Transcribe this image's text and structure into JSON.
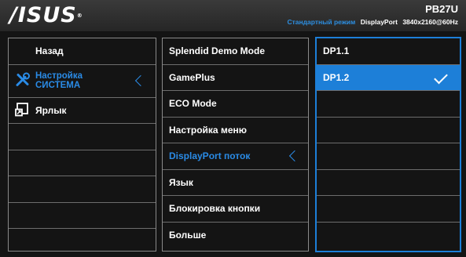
{
  "header": {
    "logo": "/ISUS",
    "model": "PB27U",
    "mode": "Стандартный режим",
    "input": "DisplayPort",
    "resolution": "3840x2160@60Hz"
  },
  "col1": {
    "back": "Назад",
    "system_line1": "Настройка",
    "system_line2": "СИСТЕМА",
    "shortcut": "Ярлык"
  },
  "col2": {
    "items": [
      "Splendid Demo Mode",
      "GamePlus",
      "ECO Mode",
      "Настройка меню",
      "DisplayPort поток",
      "Язык",
      "Блокировка кнопки",
      "Больше"
    ]
  },
  "col3": {
    "items": [
      "DP1.1",
      "DP1.2"
    ]
  },
  "colors": {
    "accent": "#1d7fd8",
    "text_accent": "#2a8be6"
  }
}
